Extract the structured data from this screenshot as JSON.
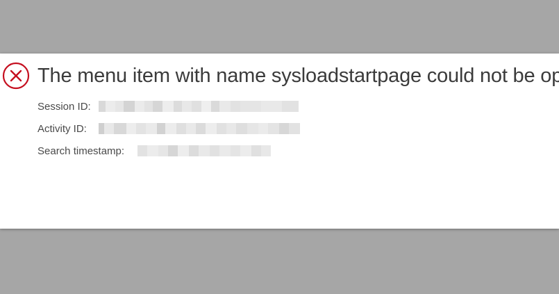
{
  "dialog": {
    "title": "The menu item with name sysloadstartpage could not be opened.",
    "icon": "error-circle-x-icon",
    "accent_color": "#c50f1f",
    "fields": [
      {
        "label": "Session ID:",
        "value_redacted": true
      },
      {
        "label": "Activity ID:",
        "value_redacted": true
      },
      {
        "label": "Search timestamp:",
        "value_redacted": true
      }
    ]
  },
  "background_color": "#a6a6a6"
}
